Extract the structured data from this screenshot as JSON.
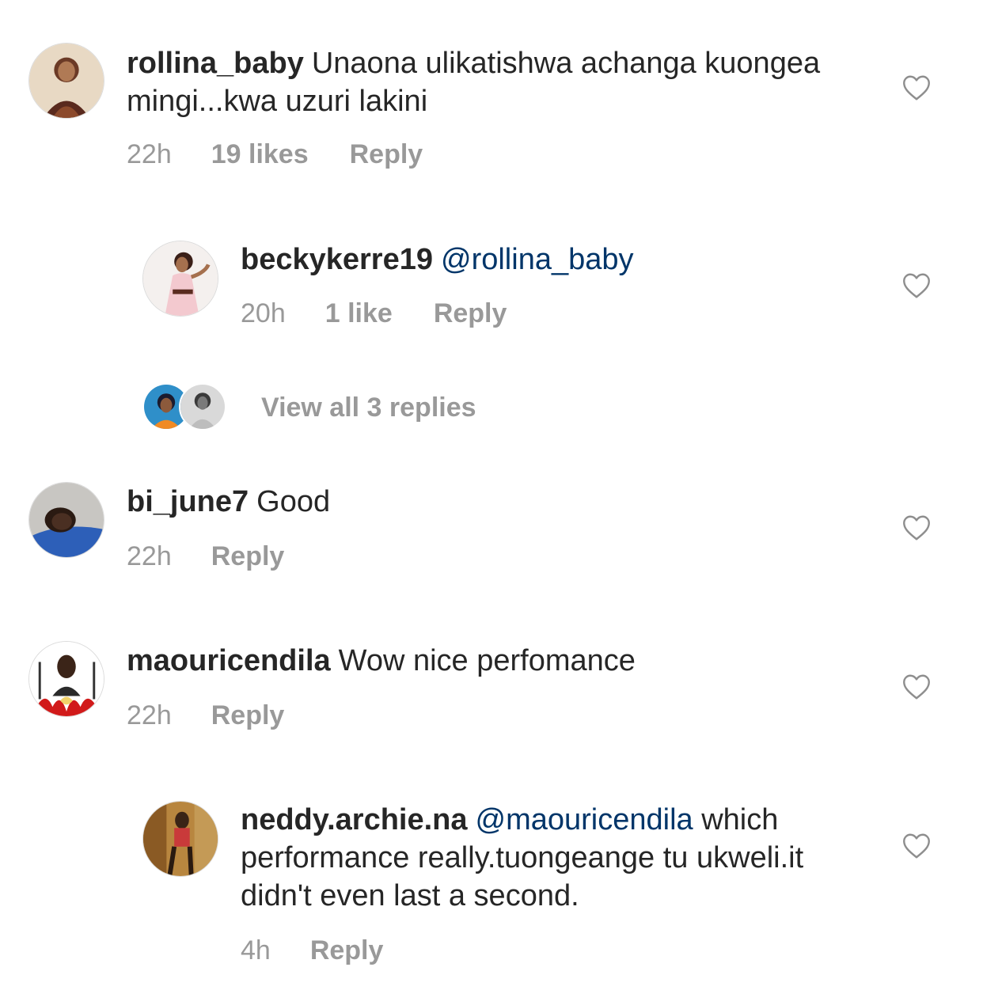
{
  "comments": [
    {
      "username": "rollina_baby",
      "mention": "",
      "text": "Unaona ulikatishwa achanga kuongea mingi...kwa uzuri lakini",
      "time": "22h",
      "likes": "19 likes",
      "reply_label": "Reply"
    },
    {
      "username": "beckykerre19",
      "mention": "@rollina_baby",
      "text": "",
      "time": "20h",
      "likes": "1 like",
      "reply_label": "Reply"
    },
    {
      "username": "bi_june7",
      "mention": "",
      "text": "Good",
      "time": "22h",
      "likes": "",
      "reply_label": "Reply"
    },
    {
      "username": "maouricendila",
      "mention": "",
      "text": "Wow nice perfomance",
      "time": "22h",
      "likes": "",
      "reply_label": "Reply"
    },
    {
      "username": "neddy.archie.na",
      "mention": "@maouricendila",
      "text": "which performance really.tuongeange tu ukweli.it didn't even last a second.",
      "time": "4h",
      "likes": "",
      "reply_label": "Reply"
    }
  ],
  "view_replies_label": "View all 3 replies",
  "icons": {
    "like": "heart-outline-icon"
  },
  "colors": {
    "text": "#262626",
    "meta": "#999999",
    "mention": "#003569"
  }
}
